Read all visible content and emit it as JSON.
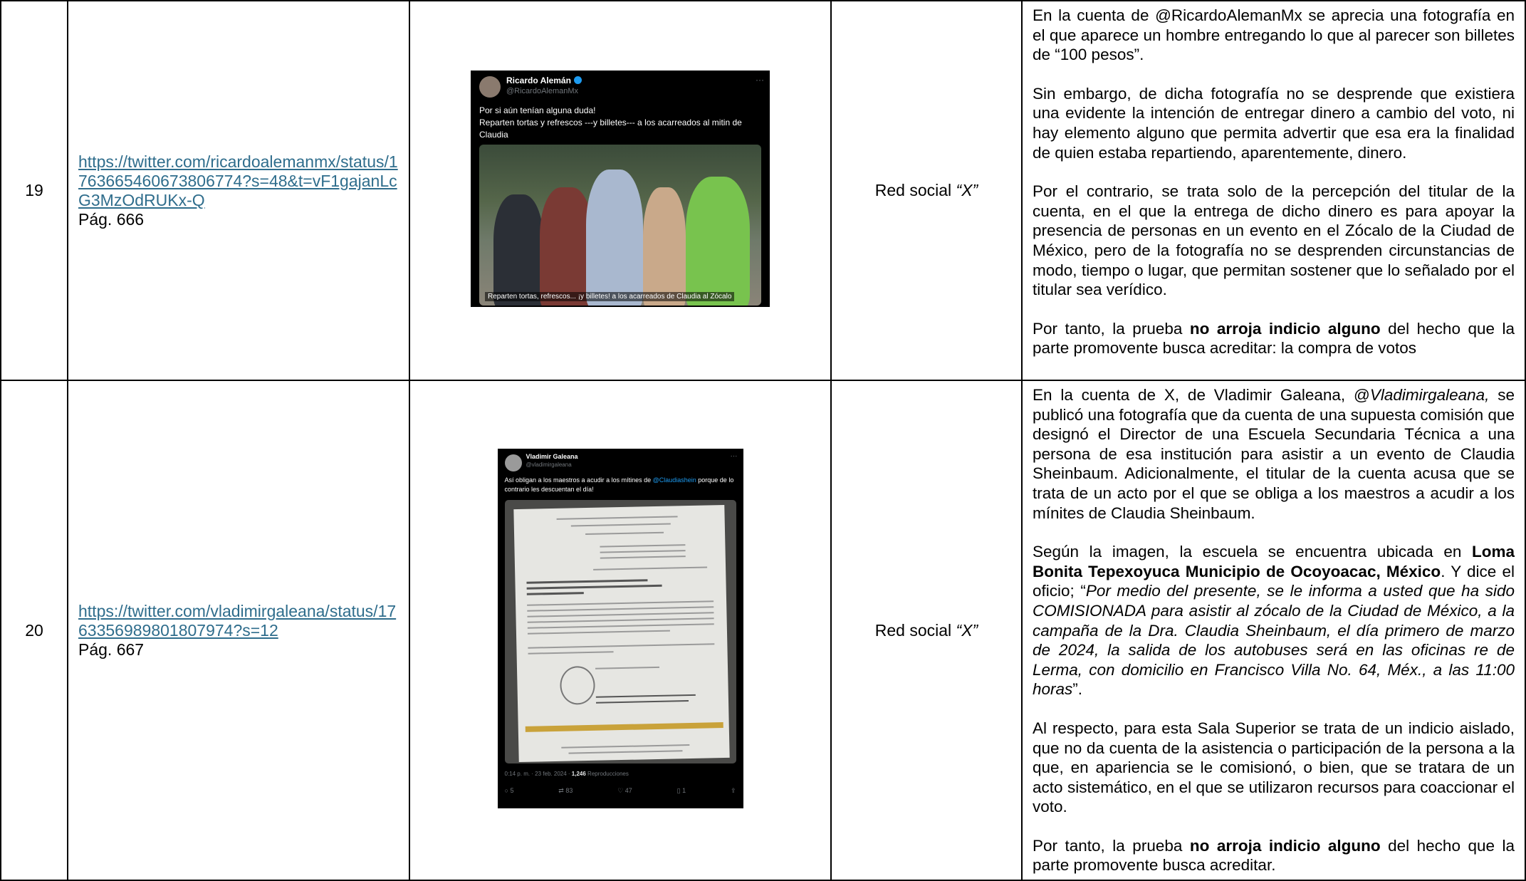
{
  "rows": [
    {
      "number": "19",
      "url": "https://twitter.com/ricardoalemanmx/status/1763665460673806774?s=48&t=vF1gajanLcG3MzOdRUKx-Q",
      "page": "Pág. 666",
      "medium_prefix": "Red social ",
      "medium_name": "“X”",
      "tweet": {
        "author": "Ricardo Alemán",
        "handle": "@RicardoAlemanMx",
        "text_line1": "Por si aún tenían alguna duda!",
        "text_line2": "Reparten tortas y refrescos ---y billetes--- a los acarreados al mitin de Claudia",
        "photo_caption": "Reparten tortas, refrescos... ¡y billetes! a los acarreados de Claudia al Zócalo",
        "more_icon": "ellipsis-icon",
        "verified_color": "#1d9bf0"
      },
      "paragraphs": [
        {
          "text": "En la cuenta de @RicardoAlemanMx se aprecia una fotografía en el que aparece un hombre entregando lo que al parecer son billetes de “100 pesos”."
        },
        {
          "text": "Sin embargo, de dicha fotografía no se desprende que existiera una evidente la intención de entregar dinero a cambio del voto, ni hay elemento alguno que permita advertir que esa era la finalidad de quien estaba repartiendo, aparentemente, dinero."
        },
        {
          "text": "Por el contrario, se trata solo de la percepción del titular de la cuenta, en el que la entrega de dicho dinero es para apoyar la presencia de personas en un evento en el Zócalo de la Ciudad de México, pero de la fotografía no se desprenden circunstancias de modo, tiempo o lugar, que permitan sostener que lo señalado por el titular sea verídico."
        },
        {
          "before": "Por tanto, la prueba ",
          "bold": "no arroja indicio alguno",
          "after": " del hecho que la parte promovente busca acreditar: la compra de votos"
        }
      ]
    },
    {
      "number": "20",
      "url": "https://twitter.com/vladimirgaleana/status/1763356989801807974?s=12",
      "page": "Pág. 667",
      "medium_prefix": "Red social ",
      "medium_name": "“X”",
      "tweet": {
        "author": "Vladimir Galeana",
        "handle": "@vladimirgaleana",
        "text_before": "Así obligan a los maestros a acudir a los mítines de ",
        "mention": "@Claudiashein",
        "text_after": " porque de lo contrario les descuentan el día!",
        "meta_time": "0:14 p. m. · 23 feb. 2024 · ",
        "meta_views": "1,246",
        "meta_views_label": " Reproducciones",
        "replies": "5",
        "reposts": "83",
        "likes": "47",
        "bookmarks": "1",
        "more_icon": "ellipsis-icon"
      },
      "paragraphs": [
        {
          "before": "En la cuenta de X, de Vladimir Galeana, @",
          "italic": "Vladimirgaleana,",
          "after": " se publicó una fotografía que da cuenta de una supuesta comisión que designó el Director de una Escuela Secundaria Técnica a una persona de esa institución para asistir a un evento de Claudia Sheinbaum. Adicionalmente, el titular de la cuenta acusa que se trata de un acto por el que se obliga a los maestros a acudir a los mínites de Claudia Sheinbaum."
        },
        {
          "before": "Según la imagen, la escuela se encuentra ubicada en ",
          "bold": "Loma Bonita Tepexoyuca Municipio de Ocoyoacac, México",
          "middle": ". Y dice el oficio; “",
          "italic": "Por medio del presente, se le informa a usted que ha sido COMISIONADA para asistir al zócalo de la Ciudad de México, a la campaña de la Dra. Claudia Sheinbaum, el día primero de marzo de 2024, la salida de los autobuses será en las oficinas re de Lerma, con domicilio en Francisco Villa No. 64, Méx., a las 11:00 horas",
          "after": "”."
        },
        {
          "text": "Al respecto, para esta Sala Superior se trata de un indicio aislado, que no da cuenta de la asistencia o participación de la persona a la que, en apariencia se le comisionó, o bien, que se tratara de un acto sistemático, en el que se utilizaron recursos para coaccionar el voto."
        },
        {
          "before": "Por tanto, la prueba ",
          "bold": "no arroja indicio alguno",
          "after": " del hecho que la parte promovente busca acreditar."
        }
      ]
    }
  ]
}
